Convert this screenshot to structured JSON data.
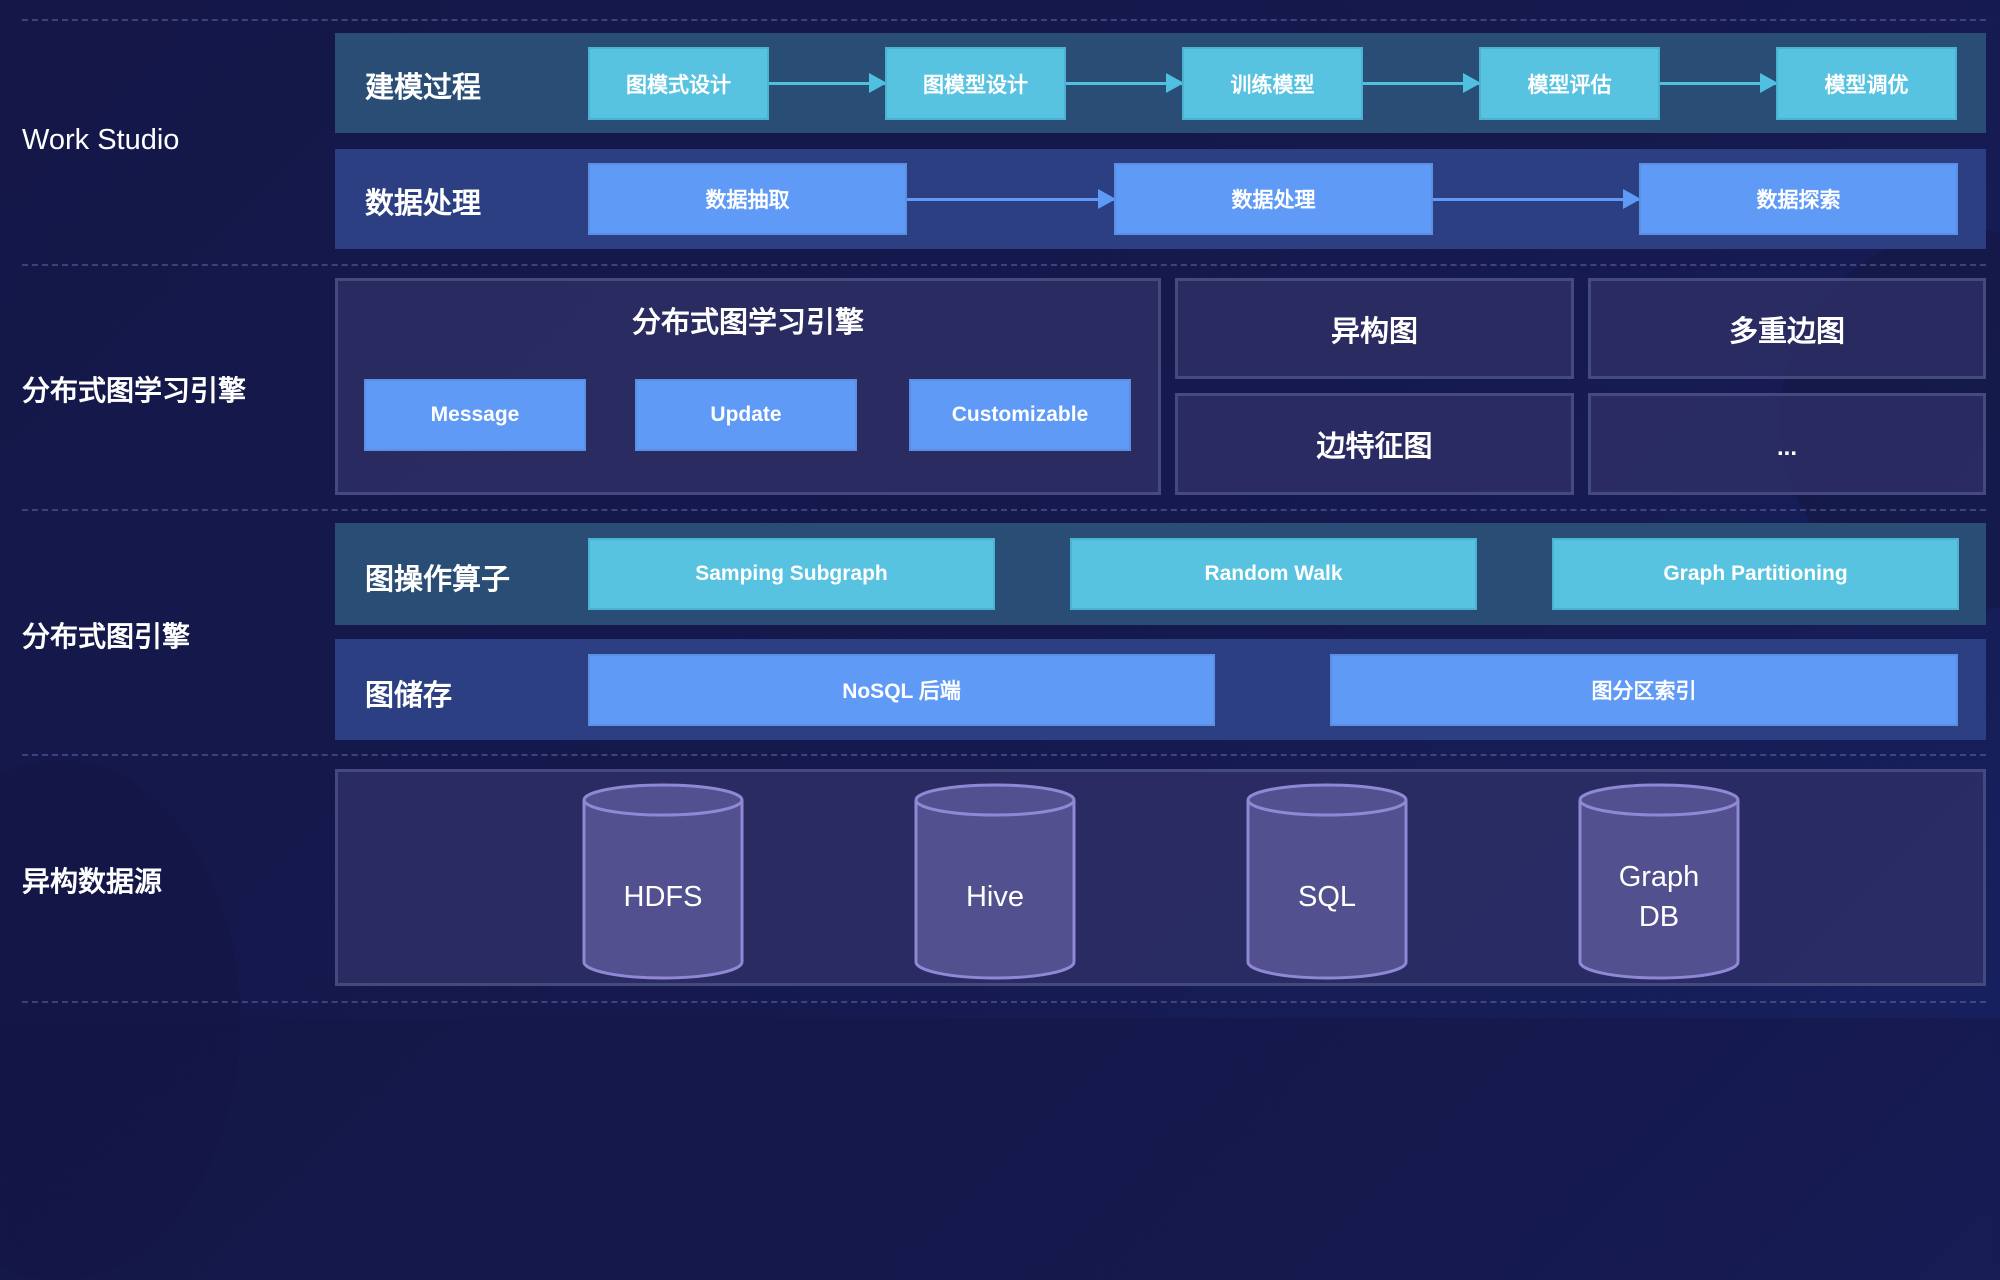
{
  "layers": [
    {
      "label": "Work Studio"
    },
    {
      "label": "分布式图学习引擎"
    },
    {
      "label": "分布式图引擎"
    },
    {
      "label": "异构数据源"
    }
  ],
  "work_studio": {
    "modeling": {
      "title": "建模过程",
      "steps": [
        "图模式设计",
        "图模型设计",
        "训练模型",
        "模型评估",
        "模型调优"
      ]
    },
    "data_processing": {
      "title": "数据处理",
      "steps": [
        "数据抽取",
        "数据处理",
        "数据探索"
      ]
    }
  },
  "learning_engine": {
    "title": "分布式图学习引擎",
    "modules": [
      "Message",
      "Update",
      "Customizable"
    ],
    "graph_types": [
      "异构图",
      "多重边图",
      "边特征图",
      "..."
    ]
  },
  "graph_engine": {
    "operators": {
      "title": "图操作算子",
      "items": [
        "Samping Subgraph",
        "Random Walk",
        "Graph Partitioning"
      ]
    },
    "storage": {
      "title": "图储存",
      "items": [
        "NoSQL 后端",
        "图分区索引"
      ]
    }
  },
  "data_sources": {
    "items": [
      "HDFS",
      "Hive",
      "SQL",
      "Graph\nDB"
    ]
  },
  "colors": {
    "background": "#141748",
    "cyan_box": "#58c3e1",
    "blue_box": "#5e9af6",
    "teal_band": "#2a4d75",
    "blue_band": "#2b3f82",
    "panel": "#303268",
    "cylinder_fill": "#52508f",
    "cylinder_stroke": "#9088d4"
  }
}
